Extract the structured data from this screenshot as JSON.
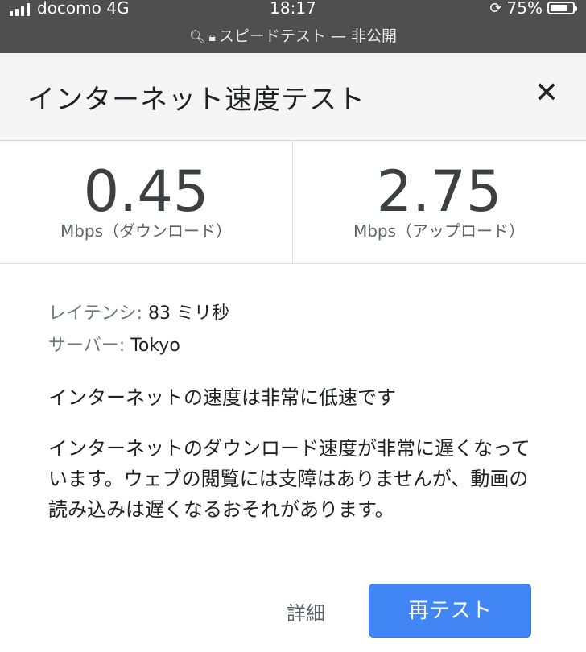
{
  "status_bar": {
    "carrier": "docomo 4G",
    "time": "18:17",
    "battery_percent": "75%",
    "battery_level": 0.75
  },
  "browser": {
    "url_text": "スピードテスト — 非公開",
    "search_icon": "search-icon",
    "lock_icon": "lock-icon"
  },
  "header": {
    "title": "インターネット速度テスト",
    "close_icon": "close-icon"
  },
  "speed": {
    "download_value": "0.45",
    "download_unit": "Mbps（ダウンロード）",
    "upload_value": "2.75",
    "upload_unit": "Mbps（アップロード）"
  },
  "info": {
    "latency_label": "レイテンシ: ",
    "latency_value": "83 ミリ秒",
    "server_label": "サーバー: ",
    "server_value": "Tokyo"
  },
  "verdict": "インターネットの速度は非常に低速です",
  "description": "インターネットのダウンロード速度が非常に遅くなっています。ウェブの閲覧には支障はありませんが、動画の読み込みは遅くなるおそれがあります。",
  "actions": {
    "details_label": "詳細",
    "retest_label": "再テスト"
  },
  "colors": {
    "accent": "#4285f4",
    "status_bar_bg": "#4f4f4f",
    "header_bg": "#f5f5f5"
  }
}
